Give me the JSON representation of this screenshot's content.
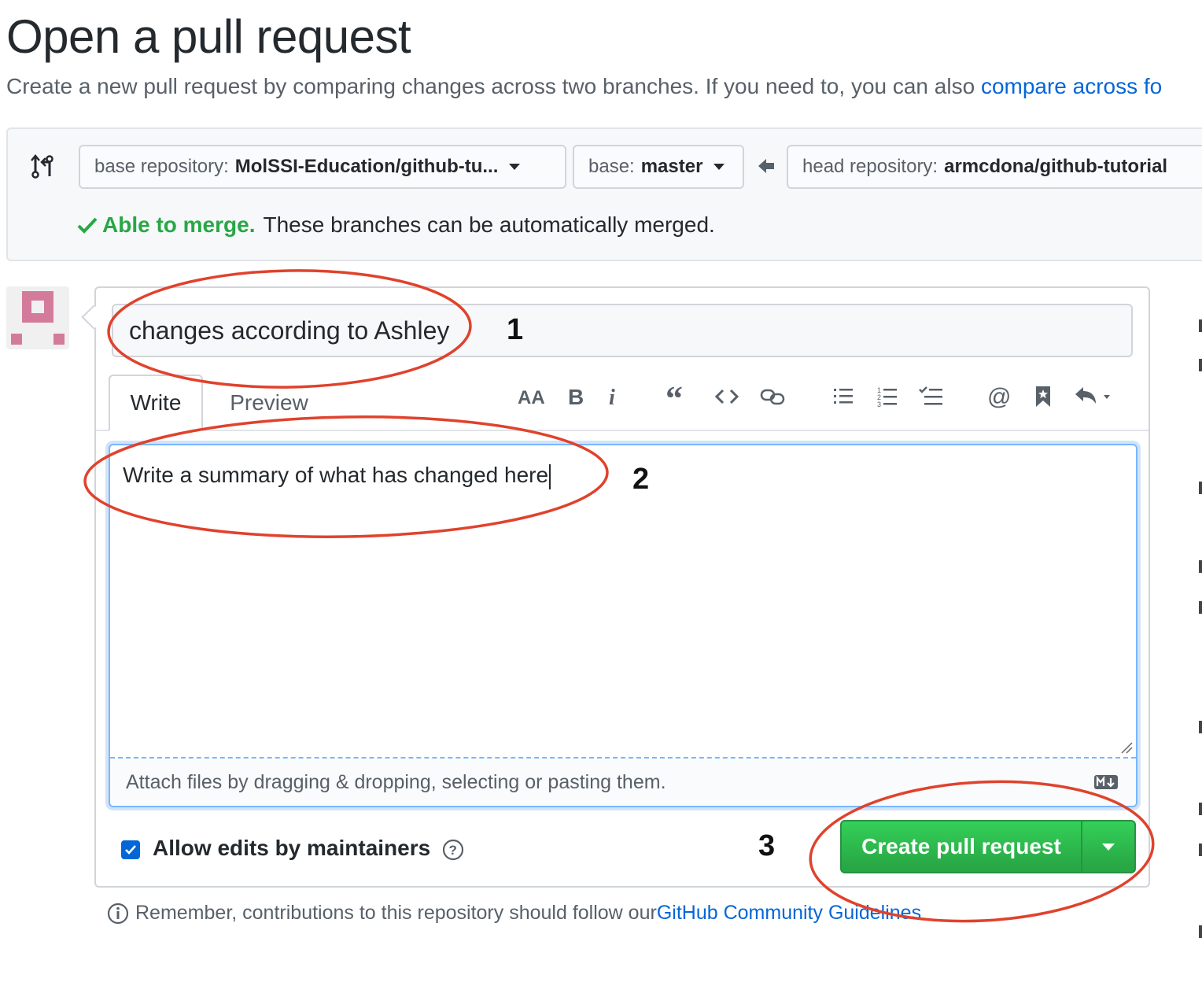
{
  "page": {
    "title": "Open a pull request",
    "subtitle_text": "Create a new pull request by comparing changes across two branches. If you need to, you can also ",
    "subtitle_link": "compare across fo"
  },
  "compare": {
    "base_repo_label": "base repository:",
    "base_repo_value": "MolSSI-Education/github-tu...",
    "base_label": "base:",
    "base_value": "master",
    "head_repo_label": "head repository:",
    "head_repo_value": "armcdona/github-tutorial",
    "merge_ok": "Able to merge.",
    "merge_text": "These branches can be automatically merged."
  },
  "form": {
    "title_value": "changes according to Ashley",
    "tabs": [
      {
        "label": "Write",
        "active": true
      },
      {
        "label": "Preview",
        "active": false
      }
    ],
    "toolbar": [
      "text-size-icon",
      "bold-icon",
      "italic-icon",
      "quote-icon",
      "code-icon",
      "link-icon",
      "unordered-list-icon",
      "ordered-list-icon",
      "task-list-icon",
      "mention-icon",
      "saved-reply-icon",
      "reply-icon"
    ],
    "body_value": "Write a summary of what has changed here",
    "attach_text": "Attach files by dragging & dropping, selecting or pasting them.",
    "allow_edits_label": "Allow edits by maintainers",
    "allow_edits_checked": true,
    "create_button": "Create pull request"
  },
  "footer": {
    "remember_text": "Remember, contributions to this repository should follow our ",
    "guidelines_link": "GitHub Community Guidelines"
  },
  "annotations": {
    "n1": "1",
    "n2": "2",
    "n3": "3"
  },
  "colors": {
    "accent_blue": "#0366d6",
    "success_green": "#28a745",
    "annotation_red": "#e0422c"
  }
}
